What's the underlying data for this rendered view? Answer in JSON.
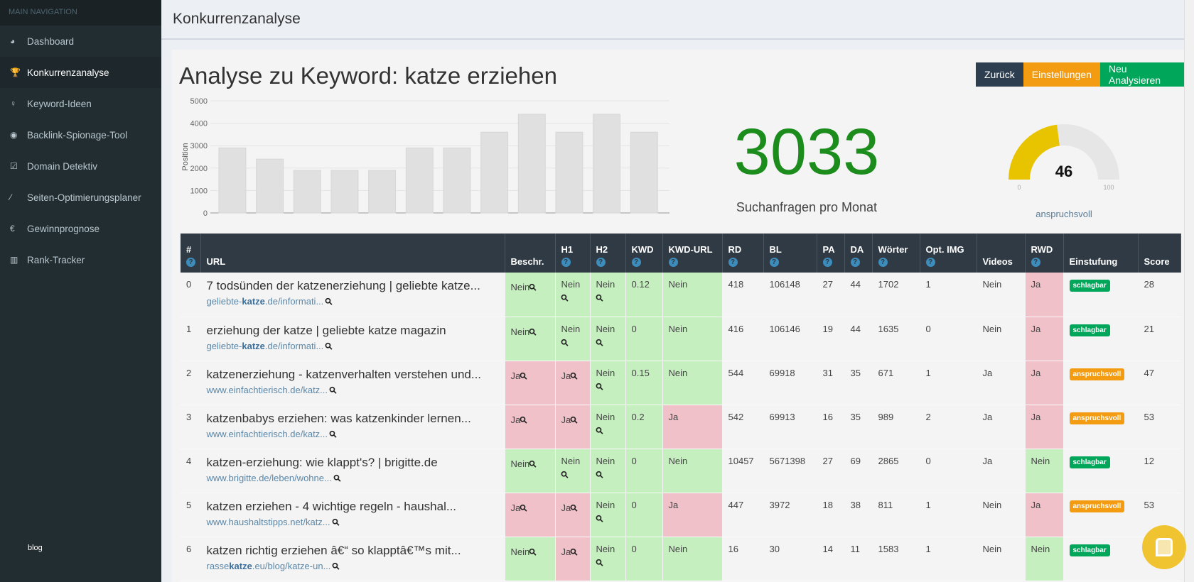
{
  "sidebar": {
    "header": "MAIN NAVIGATION",
    "items": [
      {
        "label": "Dashboard",
        "icon": "dashboard-icon",
        "glyph": "◕"
      },
      {
        "label": "Konkurrenzanalyse",
        "icon": "trophy-icon",
        "glyph": "🏆",
        "active": true
      },
      {
        "label": "Keyword-Ideen",
        "icon": "lightbulb-icon",
        "glyph": "♀"
      },
      {
        "label": "Backlink-Spionage-Tool",
        "icon": "eye-icon",
        "glyph": "◉"
      },
      {
        "label": "Domain Detektiv",
        "icon": "checkbox-icon",
        "glyph": "☑"
      },
      {
        "label": "Seiten-Optimierungsplaner",
        "icon": "magic-wand-icon",
        "glyph": "⁄"
      },
      {
        "label": "Gewinnprognose",
        "icon": "euro-icon",
        "glyph": "€"
      },
      {
        "label": "Rank-Tracker",
        "icon": "bar-chart-icon",
        "glyph": "▥"
      }
    ],
    "blog": "blog"
  },
  "header": {
    "title": "Konkurrenzanalyse"
  },
  "main": {
    "title": "Analyse zu Keyword: katze erziehen",
    "buttons": [
      {
        "label": "Zurück",
        "color": "#2c3e50"
      },
      {
        "label": "Einstellungen",
        "color": "#f39c12"
      },
      {
        "label": "Neu Analysieren",
        "color": "#00a65a"
      }
    ],
    "search_volume": "3033",
    "search_volume_label": "Suchanfragen pro Monat",
    "gauge": {
      "value": 46,
      "min": "0",
      "max": "100",
      "label": "anspruchsvoll",
      "color": "#e8c400"
    }
  },
  "chart_data": {
    "type": "bar",
    "ylabel": "Position",
    "ylim": [
      0,
      5000
    ],
    "yticks": [
      "0",
      "1000",
      "2000",
      "3000",
      "4000",
      "5000"
    ],
    "values": [
      2900,
      2400,
      1900,
      1900,
      1900,
      2900,
      2900,
      3600,
      4400,
      3600,
      4400,
      3600
    ]
  },
  "table": {
    "columns": [
      "#",
      "URL",
      "Beschr.",
      "H1",
      "H2",
      "KWD",
      "KWD-URL",
      "RD",
      "BL",
      "PA",
      "DA",
      "Wörter",
      "Opt. IMG",
      "Videos",
      "RWD",
      "Einstufung",
      "Score"
    ],
    "help": [
      true,
      false,
      false,
      true,
      true,
      true,
      true,
      true,
      true,
      true,
      true,
      true,
      true,
      false,
      true,
      false,
      false
    ],
    "badge_colors": {
      "schlagbar": "#00a65a",
      "anspruchsvoll": "#f39c12"
    },
    "rows": [
      {
        "n": "0",
        "title": "7 todsünden der katzenerziehung | geliebte katze...",
        "url": [
          "geliebte-",
          "katze",
          ".de/informati..."
        ],
        "beschr": "Nein",
        "h1": "Nein",
        "h2": "Nein",
        "kwd": "0.12",
        "kwdurl": "Nein",
        "rd": "418",
        "bl": "106148",
        "pa": "27",
        "da": "44",
        "words": "1702",
        "img": "1",
        "videos": "Nein",
        "rwd": "Ja",
        "rating": "schlagbar",
        "score": "28"
      },
      {
        "n": "1",
        "title": "erziehung der katze | geliebte katze magazin",
        "url": [
          "geliebte-",
          "katze",
          ".de/informati..."
        ],
        "beschr": "Nein",
        "h1": "Nein",
        "h2": "Nein",
        "kwd": "0",
        "kwdurl": "Nein",
        "rd": "416",
        "bl": "106146",
        "pa": "19",
        "da": "44",
        "words": "1635",
        "img": "0",
        "videos": "Nein",
        "rwd": "Ja",
        "rating": "schlagbar",
        "score": "21"
      },
      {
        "n": "2",
        "title": "katzenerziehung - katzenverhalten verstehen und...",
        "url": [
          "www.einfachtierisch.de/katz...",
          "",
          ""
        ],
        "beschr": "Ja",
        "h1": "Ja",
        "h2": "Nein",
        "kwd": "0.15",
        "kwdurl": "Nein",
        "rd": "544",
        "bl": "69918",
        "pa": "31",
        "da": "35",
        "words": "671",
        "img": "1",
        "videos": "Ja",
        "rwd": "Ja",
        "rating": "anspruchsvoll",
        "score": "47"
      },
      {
        "n": "3",
        "title": "katzenbabys erziehen: was katzenkinder lernen...",
        "url": [
          "www.einfachtierisch.de/katz...",
          "",
          ""
        ],
        "beschr": "Ja",
        "h1": "Ja",
        "h2": "Nein",
        "kwd": "0.2",
        "kwdurl": "Ja",
        "rd": "542",
        "bl": "69913",
        "pa": "16",
        "da": "35",
        "words": "989",
        "img": "2",
        "videos": "Ja",
        "rwd": "Ja",
        "rating": "anspruchsvoll",
        "score": "53"
      },
      {
        "n": "4",
        "title": "katzen-erziehung: wie klappt's? | brigitte.de",
        "url": [
          "www.brigitte.de/leben/wohne...",
          "",
          ""
        ],
        "beschr": "Nein",
        "h1": "Nein",
        "h2": "Nein",
        "kwd": "0",
        "kwdurl": "Nein",
        "rd": "10457",
        "bl": "5671398",
        "pa": "27",
        "da": "69",
        "words": "2865",
        "img": "0",
        "videos": "Ja",
        "rwd": "Nein",
        "rating": "schlagbar",
        "score": "12"
      },
      {
        "n": "5",
        "title": "katzen erziehen - 4 wichtige regeln - haushal...",
        "url": [
          "www.haushaltstipps.net/katz...",
          "",
          ""
        ],
        "beschr": "Ja",
        "h1": "Ja",
        "h2": "Nein",
        "kwd": "0",
        "kwdurl": "Ja",
        "rd": "447",
        "bl": "3972",
        "pa": "18",
        "da": "38",
        "words": "811",
        "img": "1",
        "videos": "Nein",
        "rwd": "Ja",
        "rating": "anspruchsvoll",
        "score": "53"
      },
      {
        "n": "6",
        "title": "katzen richtig erziehen â€“ so klapptâ€™s mit...",
        "url": [
          "rasse",
          "katze",
          ".eu/blog/katze-un..."
        ],
        "beschr": "Nein",
        "h1": "Ja",
        "h2": "Nein",
        "kwd": "0",
        "kwdurl": "Nein",
        "rd": "16",
        "bl": "30",
        "pa": "14",
        "da": "11",
        "words": "1583",
        "img": "1",
        "videos": "Nein",
        "rwd": "Nein",
        "rating": "schlagbar",
        "score": ""
      }
    ]
  }
}
